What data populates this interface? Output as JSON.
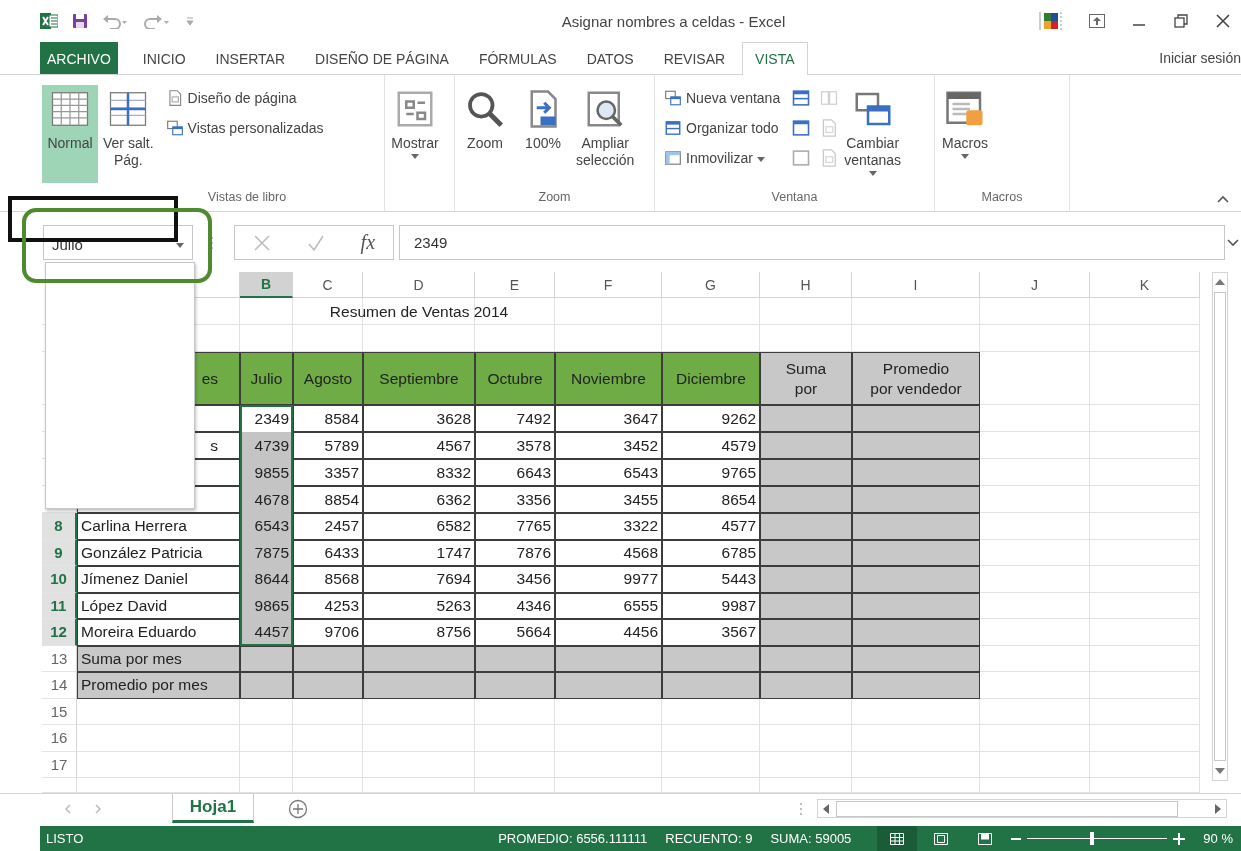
{
  "window": {
    "title": "Asignar nombres a celdas - Excel"
  },
  "ribbon_tabs": [
    {
      "label": "ARCHIVO",
      "kind": "file",
      "selected": false
    },
    {
      "label": "INICIO",
      "kind": "tab",
      "selected": false
    },
    {
      "label": "INSERTAR",
      "kind": "tab",
      "selected": false
    },
    {
      "label": "DISEÑO DE PÁGINA",
      "kind": "tab",
      "selected": false
    },
    {
      "label": "FÓRMULAS",
      "kind": "tab",
      "selected": false
    },
    {
      "label": "DATOS",
      "kind": "tab",
      "selected": false
    },
    {
      "label": "REVISAR",
      "kind": "tab",
      "selected": false
    },
    {
      "label": "VISTA",
      "kind": "tab",
      "selected": true
    }
  ],
  "account": "Iniciar sesión",
  "ribbon_groups": [
    {
      "label": "Vistas de libro",
      "controls": [
        {
          "kind": "large",
          "label": "Normal",
          "selected": true,
          "menu": false
        },
        {
          "kind": "large",
          "label": "Ver salt.\nPág.",
          "selected": false,
          "menu": false
        },
        {
          "kind": "stack",
          "items": [
            {
              "label": "Diseño de página",
              "menu": false
            },
            {
              "label": "Vistas personalizadas",
              "menu": false
            }
          ]
        }
      ]
    },
    {
      "controls": [
        {
          "kind": "large",
          "label": "Mostrar",
          "selected": false,
          "menu": true
        }
      ]
    },
    {
      "label": "Zoom",
      "controls": [
        {
          "kind": "large",
          "label": "Zoom",
          "selected": false,
          "menu": false
        },
        {
          "kind": "large",
          "label": "100%",
          "selected": false,
          "menu": false
        },
        {
          "kind": "large",
          "label": "Ampliar\nselección",
          "selected": false,
          "menu": false
        }
      ]
    },
    {
      "label": "Ventana",
      "controls": [
        {
          "kind": "stack",
          "items": [
            {
              "label": "Nueva ventana",
              "menu": false
            },
            {
              "label": "Organizar todo",
              "menu": false
            },
            {
              "label": "Inmovilizar",
              "menu": true
            }
          ]
        },
        {
          "kind": "icons",
          "items": [
            {
              "disabled": false
            },
            {
              "disabled": false
            },
            {
              "disabled": false
            }
          ]
        },
        {
          "kind": "icons",
          "items": [
            {
              "disabled": true
            },
            {
              "disabled": true
            },
            {
              "disabled": true
            }
          ]
        },
        {
          "kind": "large",
          "label": "Cambiar\nventanas",
          "selected": false,
          "menu": true
        }
      ]
    },
    {
      "label": "Macros",
      "controls": [
        {
          "kind": "large",
          "label": "Macros",
          "selected": false,
          "menu": true
        }
      ]
    }
  ],
  "name_box": {
    "value": "Julio",
    "expanded": true
  },
  "formula_bar": {
    "function_label": "fx",
    "value": "2349"
  },
  "grid": {
    "columns": [
      {
        "selected": false
      },
      {
        "label": "B",
        "selected": true
      },
      {
        "label": "C",
        "selected": false
      },
      {
        "label": "D",
        "selected": false
      },
      {
        "label": "E",
        "selected": false
      },
      {
        "label": "F",
        "selected": false
      },
      {
        "label": "G",
        "selected": false
      },
      {
        "label": "H",
        "selected": false
      },
      {
        "label": "I",
        "selected": false
      },
      {
        "label": "J",
        "selected": false
      },
      {
        "label": "K",
        "selected": false
      }
    ],
    "rows": [
      {
        "kind": "title",
        "cells": [
          null,
          null,
          null,
          "Resumen de Ventas 2014",
          null,
          null,
          null,
          null,
          null
        ]
      },
      {
        "kind": "blank"
      },
      {
        "kind": "header",
        "cells": [
          "es",
          "Julio",
          "Agosto",
          "Septiembre",
          "Octubre",
          "Noviembre",
          "Diciembre",
          "Suma\npor",
          "Promedio\npor vendedor"
        ]
      },
      {
        "kind": "data",
        "selected": true,
        "cells": [
          null,
          "2349",
          "8584",
          "3628",
          "7492",
          "3647",
          "9262",
          null,
          null
        ]
      },
      {
        "kind": "data",
        "selected": true,
        "cells": [
          "s",
          "4739",
          "5789",
          "4567",
          "3578",
          "3452",
          "4579",
          null,
          null
        ]
      },
      {
        "kind": "data",
        "selected": true,
        "cells": [
          null,
          "9855",
          "3357",
          "8332",
          "6643",
          "6543",
          "9765",
          null,
          null
        ]
      },
      {
        "kind": "data",
        "selected": true,
        "cells": [
          null,
          "4678",
          "8854",
          "6362",
          "3356",
          "3455",
          "8654",
          null,
          null
        ]
      },
      {
        "number": "8",
        "kind": "data",
        "selected": true,
        "cells": [
          "Carlina Herrera",
          "6543",
          "2457",
          "6582",
          "7765",
          "3322",
          "4577",
          null,
          null
        ]
      },
      {
        "number": "9",
        "kind": "data",
        "selected": true,
        "cells": [
          "González Patricia",
          "7875",
          "6433",
          "1747",
          "7876",
          "4568",
          "6785",
          null,
          null
        ]
      },
      {
        "number": "10",
        "kind": "data",
        "selected": true,
        "cells": [
          "Jímenez Daniel",
          "8644",
          "8568",
          "7694",
          "3456",
          "9977",
          "5443",
          null,
          null
        ]
      },
      {
        "number": "11",
        "kind": "data",
        "selected": true,
        "cells": [
          "López David",
          "9865",
          "4253",
          "5263",
          "4346",
          "6555",
          "9987",
          null,
          null
        ]
      },
      {
        "number": "12",
        "kind": "data",
        "selected": true,
        "cells": [
          "Moreira Eduardo",
          "4457",
          "9706",
          "8756",
          "5664",
          "4456",
          "3567",
          null,
          null
        ]
      },
      {
        "number": "13",
        "kind": "summary",
        "selected": false,
        "cells": [
          "Suma por mes",
          null,
          null,
          null,
          null,
          null,
          null,
          null,
          null
        ]
      },
      {
        "number": "14",
        "kind": "summary",
        "selected": false,
        "cells": [
          "Promedio por mes",
          null,
          null,
          null,
          null,
          null,
          null,
          null,
          null
        ]
      },
      {
        "number": "15",
        "kind": "empty",
        "selected": false
      },
      {
        "number": "16",
        "kind": "empty",
        "selected": false
      },
      {
        "number": "17",
        "kind": "empty",
        "selected": false
      },
      {
        "kind": "cut"
      }
    ]
  },
  "sheet_tabs": [
    {
      "label": "Hoja1",
      "selected": true
    }
  ],
  "status_bar": {
    "status": "LISTO",
    "stats": [
      "PROMEDIO: 6556.111111",
      "RECUENTO: 9",
      "SUMA: 59005"
    ],
    "views": [
      {
        "selected": true
      },
      {
        "selected": false
      },
      {
        "selected": false
      }
    ],
    "zoom": {
      "level": 0.46,
      "label": "90 %"
    }
  },
  "annotations": [
    {
      "kind": "box",
      "color": "#111111"
    },
    {
      "kind": "rounded-box",
      "color": "#4e8a2e"
    }
  ]
}
